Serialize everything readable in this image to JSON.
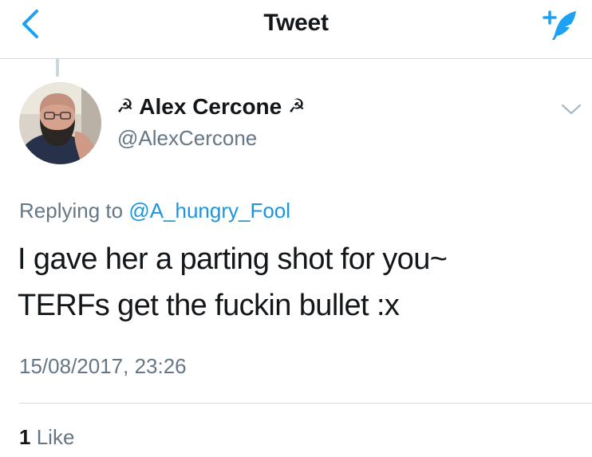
{
  "navbar": {
    "title": "Tweet",
    "back_icon": "chevron-left-icon",
    "compose_icon": "compose-quill-icon",
    "accent_color": "#1da1f2"
  },
  "tweet": {
    "author": {
      "name": "Alex Cercone",
      "name_prefix": "☭",
      "name_suffix": "☭",
      "handle": "@AlexCercone"
    },
    "replying_prefix": "Replying to",
    "replying_to": "@A_hungry_Fool",
    "text_lines": [
      "I gave her a parting shot for you~",
      "TERFs get the fuckin bullet :x"
    ],
    "timestamp": "15/08/2017, 23:26",
    "likes_count": "1",
    "likes_label": "Like"
  },
  "colors": {
    "link": "#1b95e0",
    "secondary_text": "#657786",
    "divider": "#d7dbe0"
  }
}
